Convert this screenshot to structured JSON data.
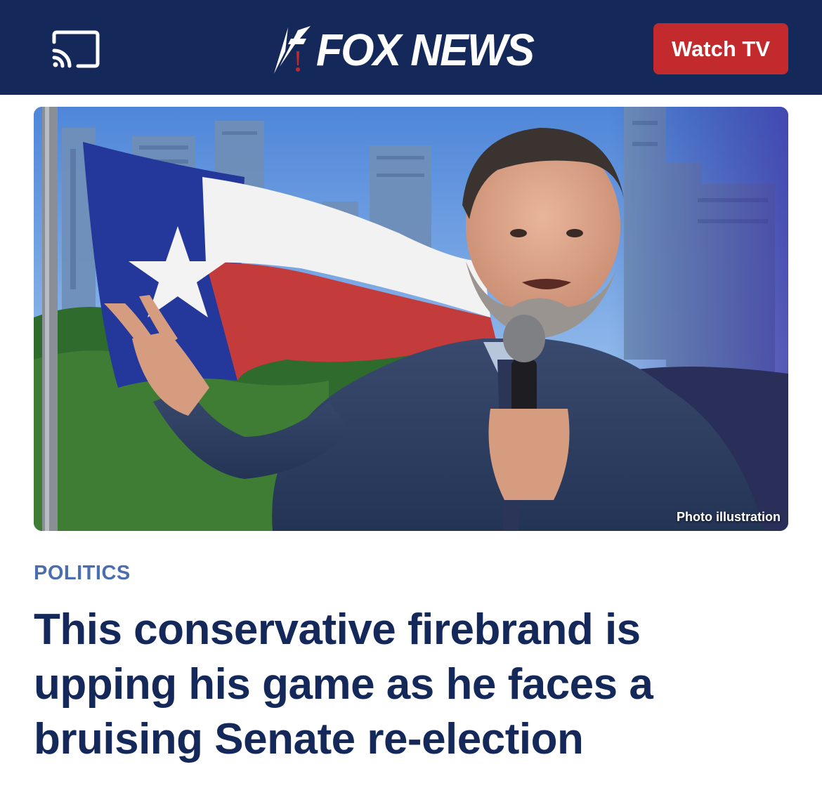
{
  "header": {
    "cast_icon": "cast-icon",
    "logo_text": "FOX NEWS",
    "watch_button_label": "Watch TV",
    "colors": {
      "background": "#14295a",
      "watch_button": "#c22a2e"
    }
  },
  "hero": {
    "caption": "Photo illustration"
  },
  "article": {
    "category": "POLITICS",
    "headline": "This conservative firebrand is upping his game as he faces a bruising Senate re-election",
    "colors": {
      "category": "#4b6fae",
      "headline": "#14295a"
    }
  }
}
